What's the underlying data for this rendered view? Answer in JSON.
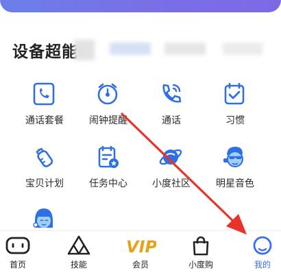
{
  "section": {
    "title": "设备超能"
  },
  "grid": [
    {
      "label": "通话套餐",
      "icon": "phone-plan-icon"
    },
    {
      "label": "闹钟提醒",
      "icon": "alarm-clock-icon"
    },
    {
      "label": "通话",
      "icon": "phone-call-icon"
    },
    {
      "label": "习惯",
      "icon": "habit-check-icon"
    },
    {
      "label": "宝贝计划",
      "icon": "baby-bottle-icon"
    },
    {
      "label": "任务中心",
      "icon": "task-clipboard-icon"
    },
    {
      "label": "小度社区",
      "icon": "planet-community-icon"
    },
    {
      "label": "明星音色",
      "icon": "star-voice-icon"
    }
  ],
  "tabs": [
    {
      "label": "首页",
      "icon": "home-speaker-icon",
      "active": false
    },
    {
      "label": "技能",
      "icon": "skills-triangle-icon",
      "active": false
    },
    {
      "label": "会员",
      "icon": "vip-icon",
      "vip_text": "VIP",
      "active": false
    },
    {
      "label": "小度购",
      "icon": "shopping-bag-icon",
      "active": false
    },
    {
      "label": "我的",
      "icon": "profile-icon",
      "active": true
    }
  ],
  "colors": {
    "accent": "#3a6df0",
    "icon_blue": "#2f6fe4",
    "arrow": "#e8322c",
    "vip_gold": "#e6a31a"
  }
}
